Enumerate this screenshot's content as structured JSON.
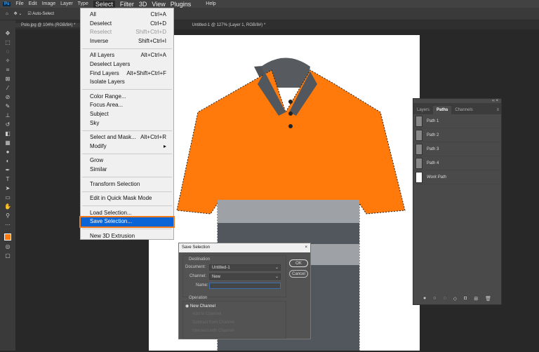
{
  "menubar": {
    "logo": "Ps",
    "items": [
      "File",
      "Edit",
      "Image",
      "Layer",
      "Type",
      "Select",
      "Filter",
      "3D",
      "View",
      "Plugins",
      "Help"
    ]
  },
  "options": {
    "auto_select": "Auto-Select"
  },
  "tabs": [
    "Polo.jpg @ 104% (RGB/8#) *",
    "Untitled-1 @ 127% (Layer 1, RGB/8#) *"
  ],
  "select_menu": [
    [
      {
        "label": "All",
        "shortcut": "Ctrl+A"
      },
      {
        "label": "Deselect",
        "shortcut": "Ctrl+D"
      },
      {
        "label": "Reselect",
        "shortcut": "Shift+Ctrl+D",
        "disabled": true
      },
      {
        "label": "Inverse",
        "shortcut": "Shift+Ctrl+I"
      }
    ],
    [
      {
        "label": "All Layers",
        "shortcut": "Alt+Ctrl+A"
      },
      {
        "label": "Deselect Layers",
        "shortcut": ""
      },
      {
        "label": "Find Layers",
        "shortcut": "Alt+Shift+Ctrl+F"
      },
      {
        "label": "Isolate Layers",
        "shortcut": ""
      }
    ],
    [
      {
        "label": "Color Range...",
        "shortcut": ""
      },
      {
        "label": "Focus Area...",
        "shortcut": ""
      },
      {
        "label": "Subject",
        "shortcut": ""
      },
      {
        "label": "Sky",
        "shortcut": ""
      }
    ],
    [
      {
        "label": "Select and Mask...",
        "shortcut": "Alt+Ctrl+R"
      },
      {
        "label": "Modify",
        "shortcut": "▸"
      }
    ],
    [
      {
        "label": "Grow",
        "shortcut": ""
      },
      {
        "label": "Similar",
        "shortcut": ""
      }
    ],
    [
      {
        "label": "Transform Selection",
        "shortcut": ""
      }
    ],
    [
      {
        "label": "Edit in Quick Mask Mode",
        "shortcut": ""
      }
    ],
    [
      {
        "label": "Load Selection...",
        "shortcut": ""
      },
      {
        "label": "Save Selection...",
        "shortcut": "",
        "highlighted": true
      }
    ],
    [
      {
        "label": "New 3D Extrusion",
        "shortcut": ""
      }
    ]
  ],
  "dialog": {
    "title": "Save Selection",
    "close": "×",
    "destination": "Destination",
    "document_label": "Document:",
    "document_value": "Untitled-1",
    "channel_label": "Channel:",
    "channel_value": "New",
    "name_label": "Name:",
    "name_value": "",
    "ok": "OK",
    "cancel": "Cancel",
    "operation": "Operation",
    "ops": [
      "New Channel",
      "Add to Channel",
      "Subtract from Channel",
      "Intersect with Channel"
    ]
  },
  "panel": {
    "tabs": [
      "Layers",
      "Paths",
      "Channels"
    ],
    "active_tab": "Paths",
    "paths": [
      "Path 1",
      "Path 2",
      "Path 3",
      "Path 4",
      "Work Path"
    ]
  },
  "colors": {
    "accent": "#0a64d6",
    "highlight_border": "#f07a1c",
    "shirt_orange": "#ff7a0a",
    "shirt_grey": "#555a60"
  }
}
